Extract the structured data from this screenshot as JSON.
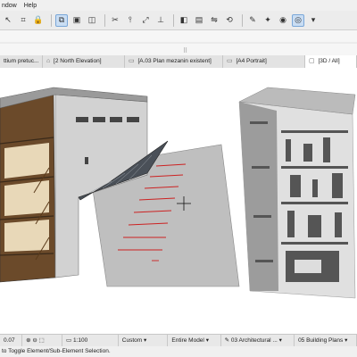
{
  "menu": {
    "window": "ndow",
    "help": "Help"
  },
  "tabs": [
    {
      "label": "ttium pretuc...",
      "icon": "section-icon"
    },
    {
      "label": "[2 North Elevation]",
      "icon": "elevation-icon"
    },
    {
      "label": "[A.03 Plan mezanin existent]",
      "icon": "layout-icon"
    },
    {
      "label": "[A4 Portrait]",
      "icon": "layout-icon"
    },
    {
      "label": "[3D / All]",
      "icon": "3d-icon"
    }
  ],
  "status": {
    "zoom_value": "0.07",
    "scale": "1:100",
    "layer_combo": "Custom",
    "model_view": "Entire Model",
    "pen_set": "03 Architectural ...",
    "plan_type": "05 Building Plans"
  },
  "hint": "to Toggle Element/Sub-Element Selection."
}
